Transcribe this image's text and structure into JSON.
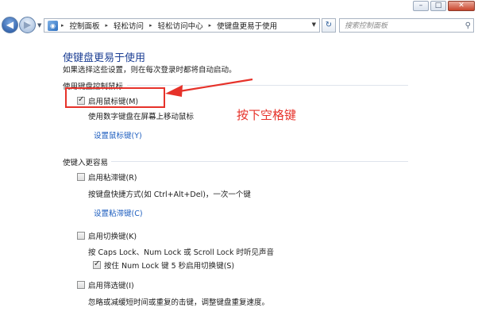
{
  "window": {
    "minimize_glyph": "–",
    "maximize_glyph": "□",
    "close_glyph": "✕"
  },
  "nav": {
    "back_glyph": "◀",
    "forward_glyph": "▶",
    "dropdown_glyph": "▼",
    "address_icon": "control-panel-icon",
    "breadcrumbs": [
      "控制面板",
      "轻松访问",
      "轻松访问中心",
      "使键盘更易于使用"
    ],
    "separator": "▸",
    "refresh_glyph": "↻",
    "search_placeholder": "搜索控制面板",
    "search_icon": "search-icon"
  },
  "page": {
    "title": "使键盘更易于使用",
    "description": "如果选择这些设置，则在每次登录时都将自动启动。"
  },
  "mouse_section": {
    "label": "使用键盘控制鼠标",
    "mouse_keys": {
      "label": "启用鼠标键(M)",
      "checked": true,
      "description": "使用数字键盘在屏幕上移动鼠标",
      "settings_link": "设置鼠标键(Y)"
    }
  },
  "easier_section": {
    "label": "使键入更容易",
    "sticky_keys": {
      "label": "启用粘滞键(R)",
      "checked": false,
      "description": "按键盘快捷方式(如 Ctrl+Alt+Del)，一次一个键",
      "settings_link": "设置粘滞键(C)"
    },
    "toggle_keys": {
      "label": "启用切换键(K)",
      "checked": false,
      "description": "按 Caps Lock、Num Lock 或 Scroll Lock 时听见声音",
      "sub_option": {
        "label": "按住 Num Lock 键 5 秒启用切换键(S)",
        "checked": true
      }
    },
    "filter_keys": {
      "label": "启用筛选键(I)",
      "checked": false,
      "description": "忽略或减缓短时间或重复的击键，调整键盘重复速度。"
    }
  },
  "annotation": {
    "text": "按下空格键",
    "color": "#e6322a"
  },
  "colors": {
    "title_blue": "#1c3f94",
    "link_blue": "#1e5ebf",
    "annotation_red": "#e6322a"
  }
}
